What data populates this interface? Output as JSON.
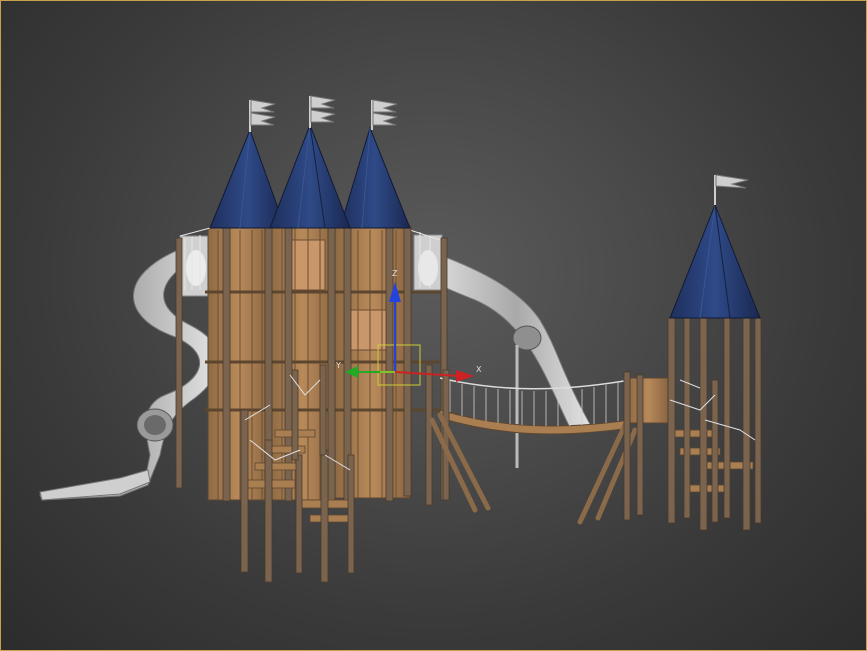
{
  "viewport": {
    "background": "#4a4a4a",
    "border_color": "#c8a14a"
  },
  "gizmo": {
    "z_label": "Z",
    "y_label": "Y",
    "x_label": "X",
    "x_color": "#cc2222",
    "y_color": "#22aa22",
    "z_color": "#2244dd"
  },
  "model": {
    "roof_color": "#263a6e",
    "wood_color": "#a97f52",
    "post_color": "#7a6450",
    "slide_color": "#bdbdbd"
  }
}
